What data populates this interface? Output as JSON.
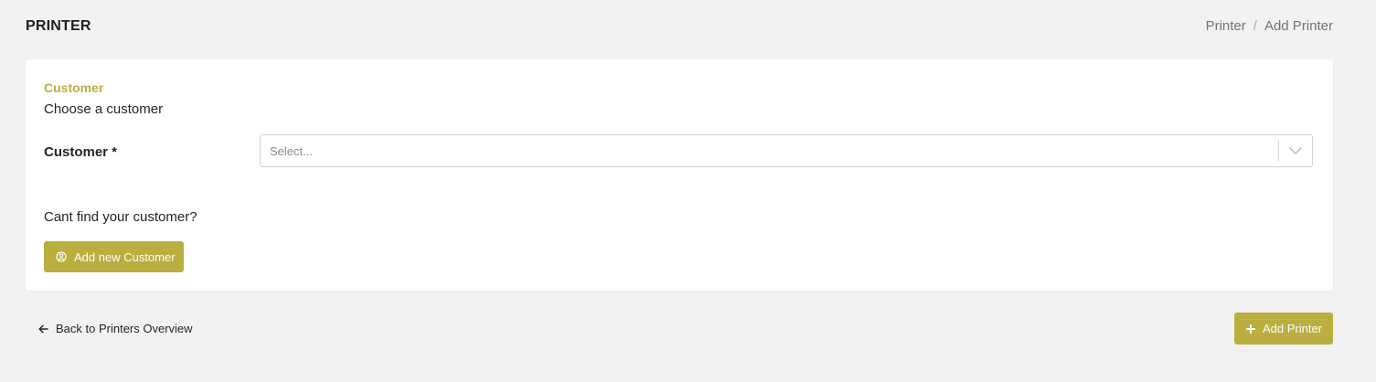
{
  "header": {
    "title": "PRINTER",
    "breadcrumb": [
      "Printer",
      "Add Printer"
    ],
    "breadcrumb_separator": "/"
  },
  "customer_section": {
    "title": "Customer",
    "subtitle": "Choose a customer",
    "field_label": "Customer *",
    "select_placeholder": "Select...",
    "cant_find_text": "Cant find your customer?",
    "add_button_label": "Add new Customer"
  },
  "footer": {
    "back_label": "Back to Printers Overview",
    "submit_label": "Add Printer"
  },
  "colors": {
    "accent": "#b9ae3f",
    "background": "#f2f2f2",
    "card": "#ffffff"
  },
  "icons": {
    "add_customer": "user-circle-icon",
    "back": "arrow-left-icon",
    "add_printer": "plus-icon",
    "select": "chevron-down-icon"
  }
}
